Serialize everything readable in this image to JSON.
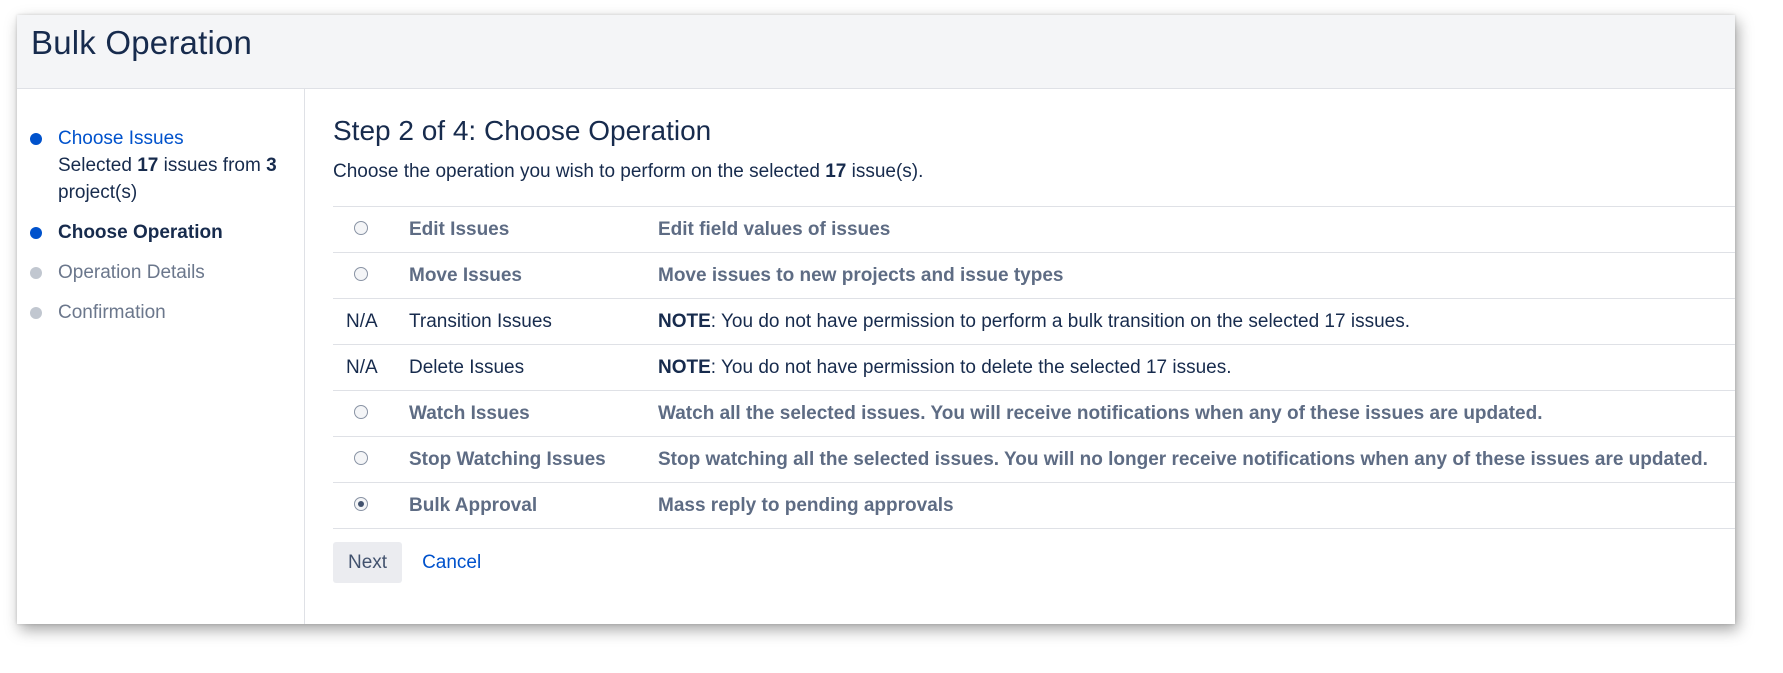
{
  "header": {
    "title": "Bulk Operation"
  },
  "sidebar": {
    "steps": [
      {
        "label": "Choose Issues",
        "sub_prefix": "Selected ",
        "sub_issues": "17",
        "sub_middle": " issues from ",
        "sub_projects": "3",
        "sub_suffix": "project(s)",
        "state": "done"
      },
      {
        "label": "Choose Operation",
        "state": "current"
      },
      {
        "label": "Operation Details",
        "state": "pending"
      },
      {
        "label": "Confirmation",
        "state": "pending"
      }
    ]
  },
  "main": {
    "title": "Step 2 of 4: Choose Operation",
    "intro_prefix": "Choose the operation you wish to perform on the selected ",
    "intro_count": "17",
    "intro_suffix": " issue(s).",
    "operations": [
      {
        "select": "radio",
        "checked": false,
        "name": "Edit Issues",
        "desc": "Edit field values of issues"
      },
      {
        "select": "radio",
        "checked": false,
        "name": "Move Issues",
        "desc": "Move issues to new projects and issue types"
      },
      {
        "select": "N/A",
        "name": "Transition Issues",
        "note": "NOTE",
        "desc": ": You do not have permission to perform a bulk transition on the selected 17 issues."
      },
      {
        "select": "N/A",
        "name": "Delete Issues",
        "note": "NOTE",
        "desc": ": You do not have permission to delete the selected 17 issues."
      },
      {
        "select": "radio",
        "checked": false,
        "name": "Watch Issues",
        "desc": "Watch all the selected issues. You will receive notifications when any of these issues are updated."
      },
      {
        "select": "radio",
        "checked": false,
        "name": "Stop Watching Issues",
        "desc": "Stop watching all the selected issues. You will no longer receive notifications when any of these issues are updated."
      },
      {
        "select": "radio",
        "checked": true,
        "name": "Bulk Approval",
        "desc": "Mass reply to pending approvals"
      }
    ],
    "next_label": "Next",
    "cancel_label": "Cancel"
  },
  "colors": {
    "accent": "#0052cc",
    "header_bg": "#f4f5f7",
    "text": "#172b4d",
    "muted": "#5e6c84"
  }
}
